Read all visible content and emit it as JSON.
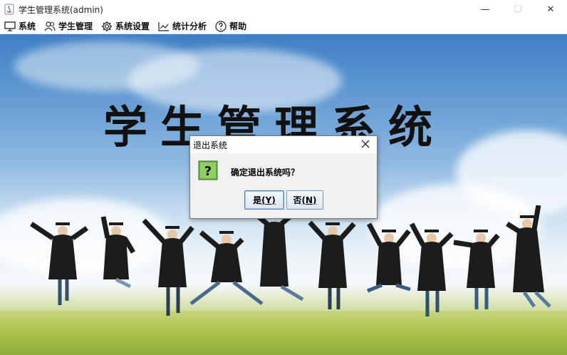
{
  "window": {
    "title": "学生管理系统(admin)",
    "minimize_glyph": "—",
    "maximize_glyph": "☐",
    "close_glyph": "✕"
  },
  "menu": {
    "items": [
      {
        "label": "系统",
        "icon": "monitor-icon"
      },
      {
        "label": "学生管理",
        "icon": "users-icon"
      },
      {
        "label": "系统设置",
        "icon": "gear-icon"
      },
      {
        "label": "统计分析",
        "icon": "chart-icon"
      },
      {
        "label": "帮助",
        "icon": "help-icon"
      }
    ]
  },
  "main": {
    "banner_title": "学生管理系统"
  },
  "dialog": {
    "title": "退出系统",
    "message": "确定退出系统吗？",
    "yes_text": "是",
    "yes_mnemonic": "(Y)",
    "no_text": "否",
    "no_mnemonic": "(N)",
    "icon": "question-icon"
  }
}
